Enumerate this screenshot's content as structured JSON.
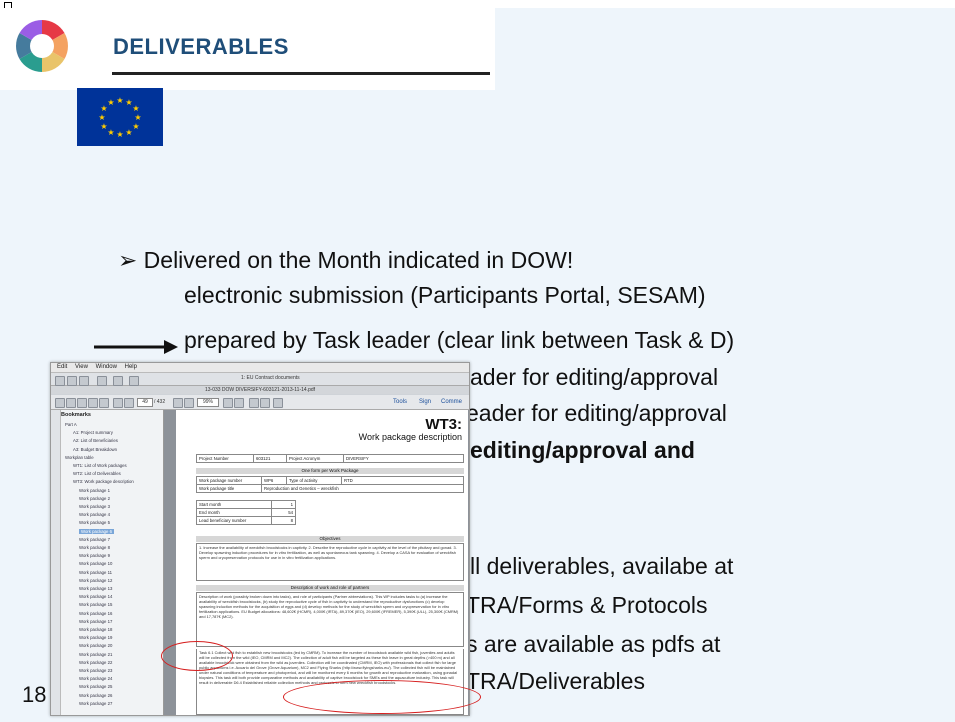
{
  "slide": {
    "title": "DELIVERABLES",
    "page_number": "18",
    "lines": [
      "➢ Delivered on the Month indicated in DOW!",
      "electronic submission (Participants Portal, SESAM)",
      "prepared by Task leader (clear link between Task & D)",
      "ader for editing/approval",
      "eader for editing/approval",
      "editing/approval and",
      "ll deliverables, availabe at",
      "TRA/Forms & Protocols",
      "s are available as pdfs at",
      "TRA/Deliverables"
    ]
  },
  "screenshot": {
    "menu": [
      "Edit",
      "View",
      "Window",
      "Help"
    ],
    "tab_title": "1: EU Contract documents",
    "file_title": "13-033 DOW DIVERSIFY-603121-2013-11-14.pdf",
    "page_input": "49",
    "page_total": "/ 432",
    "zoom": "99%",
    "tools_label": "Tools",
    "sign_label": "Sign",
    "comment_label": "Comme",
    "bookmarks_label": "Bookmarks",
    "bookmarks": [
      "Part A",
      "A1: Project summary",
      "A2: List of Beneficiaries",
      "A3: Budget Breakdown",
      "Workplan table",
      "WT1: List of Work packages",
      "WT2: List of Deliverables",
      "WT3: Work package description",
      "Work package 1",
      "Work package 2",
      "Work package 3",
      "Work package 4",
      "Work package 5",
      "Work package 6",
      "Work package 7",
      "Work package 8",
      "Work package 9",
      "Work package 10",
      "Work package 11",
      "Work package 12",
      "Work package 13",
      "Work package 14",
      "Work package 15",
      "Work package 16",
      "Work package 17",
      "Work package 18",
      "Work package 19",
      "Work package 20",
      "Work package 21",
      "Work package 22",
      "Work package 23",
      "Work package 24",
      "Work package 25",
      "Work package 26",
      "Work package 27"
    ],
    "selected_bookmark": "Work package 6",
    "doc": {
      "heading": "WT3:",
      "subheading": "Work package description",
      "project_number_label": "Project Number",
      "project_number": "603121",
      "project_acronym_label": "Project Acronym",
      "project_acronym": "DIVERSIFY",
      "form_header": "One form per Work Package",
      "wp_number_label": "Work package number",
      "wp_number": "WP6",
      "activity_label": "Type of activity",
      "activity": "RTD",
      "wp_title_label": "Work package title",
      "wp_title": "Reproduction and Genetics – wreckfish",
      "start_label": "Start month",
      "start": "1",
      "end_label": "End month",
      "end": "54",
      "lead_label": "Lead beneficiary number",
      "lead": "8",
      "objectives_header": "Objectives",
      "objectives_text": "1. Increase the availability of wreckfish broodstocks in captivity. 2. Describe the reproductive cycle in captivity at the level of the pituitary and gonad. 3. Develop spawning induction procedures for in vitro fertilization, as well as spontaneous tank spawning. 4. Develop a CASA for evaluation of wreckfish sperm and cryopreservation protocols for use in in vitro fertilization applications.",
      "description_header": "Description of work and role of partners",
      "description_text": "Description of work (possibly broken down into tasks), and role of participants (Partner abbreviations). This WP includes tasks to (a) increase the availability of wreckfish broodstocks, (b) study the reproductive cycle of fish in captivity to understand the reproductive dysfunctions (c) develop spawning induction methods for the acquisition of eggs and (d) develop methods for the study of wreckfish sperm and cryopreservation for in vitro fertilization applications. EU Budget allocations: 48,602€ (HCMR), 4,000€ (IRTA), 89,370€ (IEO), 29,600€ (IFREMER), 5,390€ (ULL), 25,300€ (CMRM) and 17,787€ (MC2).",
      "task_text": "Task 6.1 Collect wild fish to establish new broodstocks (led by CMRM). To increase the number of broodstock available wild fish, juveniles and adults will be collected from the wild (IEO, CMRM and MC2). The collection of adult fish will be targeted as these fish leave in great depths (>400 m) and all available broodstock were obtained from the wild as juveniles. Collection will be coordinated (CMRM, IEO) with professionals that collect fish for large public aquariums i.e. Acuario del Grove (Grove Aquarium), MC2 and Flying Sharks (http://www.flyingsharks.eu/). The collected fish will be maintained under natural conditions of temperature and photoperiod, and will be monitored every 6 months for growth and reproductive maturation, using gonadal biopsies. This task will both provide comparative methods and availability of captive broodstock for SMEs and the aquaculture industry. This task will result in deliverable D6.4 Established reliable collection methods and protocols to form new wreckfish broodstocks."
    }
  }
}
